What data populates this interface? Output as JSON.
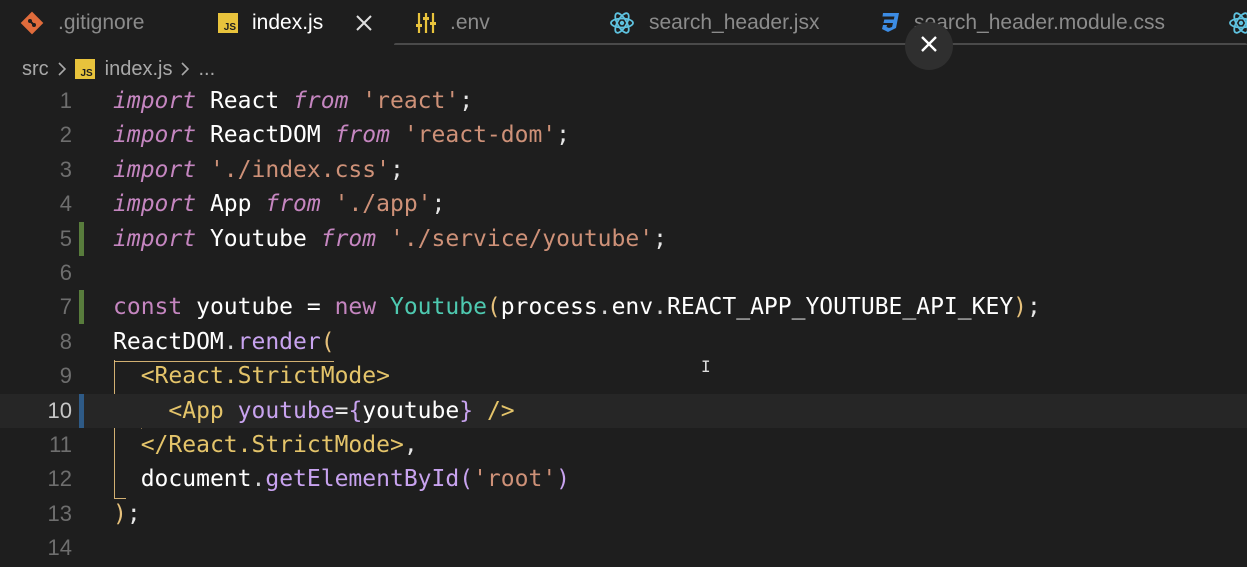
{
  "tabs": [
    {
      "label": ".gitignore",
      "icon": "git-icon"
    },
    {
      "label": "index.js",
      "icon": "js-icon",
      "active": true
    },
    {
      "label": ".env",
      "icon": "settings-sliders-icon"
    },
    {
      "label": "search_header.jsx",
      "icon": "react-icon"
    },
    {
      "label": "search_header.module.css",
      "icon": "css-icon"
    }
  ],
  "breadcrumb": {
    "folder": "src",
    "file": "index.js",
    "js_badge": "JS",
    "more": "..."
  },
  "badge_text": "JS",
  "colors": {
    "background": "#1e1e1e",
    "keyword": "#c586c0",
    "string": "#ce9178",
    "class": "#4ec9b0",
    "bracket": "#e5c07b",
    "added_marker": "#587c3c",
    "modified_marker": "#2e5a86",
    "js_badge": "#e8c33c",
    "react_icon": "#5fc3e0",
    "css_icon": "#3c8ce4",
    "git_icon": "#e06c3c"
  },
  "editor": {
    "line_numbers": [
      "1",
      "2",
      "3",
      "4",
      "5",
      "6",
      "7",
      "8",
      "9",
      "10",
      "11",
      "12",
      "13",
      "14"
    ],
    "current_line": 10,
    "lines": [
      {
        "n": 1,
        "t": [
          [
            "import",
            "kw"
          ],
          [
            " React ",
            "var"
          ],
          [
            "from",
            "kw"
          ],
          [
            " ",
            "plain"
          ],
          [
            "'react'",
            "str"
          ],
          [
            ";",
            "plain"
          ]
        ]
      },
      {
        "n": 2,
        "t": [
          [
            "import",
            "kw"
          ],
          [
            " ReactDOM ",
            "var"
          ],
          [
            "from",
            "kw"
          ],
          [
            " ",
            "plain"
          ],
          [
            "'react-dom'",
            "str"
          ],
          [
            ";",
            "plain"
          ]
        ]
      },
      {
        "n": 3,
        "t": [
          [
            "import",
            "kw"
          ],
          [
            " ",
            "plain"
          ],
          [
            "'./index.css'",
            "str"
          ],
          [
            ";",
            "plain"
          ]
        ]
      },
      {
        "n": 4,
        "t": [
          [
            "import",
            "kw"
          ],
          [
            " App ",
            "var"
          ],
          [
            "from",
            "kw"
          ],
          [
            " ",
            "plain"
          ],
          [
            "'./app'",
            "str"
          ],
          [
            ";",
            "plain"
          ]
        ]
      },
      {
        "n": 5,
        "t": [
          [
            "import",
            "kw"
          ],
          [
            " Youtube ",
            "var"
          ],
          [
            "from",
            "kw"
          ],
          [
            " ",
            "plain"
          ],
          [
            "'./service/youtube'",
            "str"
          ],
          [
            ";",
            "plain"
          ]
        ]
      },
      {
        "n": 6,
        "t": []
      },
      {
        "n": 7,
        "t": [
          [
            "const",
            "kw2"
          ],
          [
            " youtube = ",
            "var"
          ],
          [
            "new",
            "kw2"
          ],
          [
            " ",
            "plain"
          ],
          [
            "Youtube",
            "cls"
          ],
          [
            "(",
            "brace"
          ],
          [
            "process",
            "var"
          ],
          [
            ".",
            "dot"
          ],
          [
            "env",
            "var"
          ],
          [
            ".",
            "dot"
          ],
          [
            "REACT_APP_YOUTUBE_API_KEY",
            "var"
          ],
          [
            ")",
            "brace"
          ],
          [
            ";",
            "plain"
          ]
        ]
      },
      {
        "n": 8,
        "t": [
          [
            "ReactDOM",
            "var"
          ],
          [
            ".",
            "dot"
          ],
          [
            "render",
            "fn"
          ],
          [
            "(",
            "brace"
          ]
        ]
      },
      {
        "n": 9,
        "t": [
          [
            "  ",
            "plain"
          ],
          [
            "<React.StrictMode>",
            "tag"
          ]
        ]
      },
      {
        "n": 10,
        "t": [
          [
            "    ",
            "plain"
          ],
          [
            "<App",
            "tag"
          ],
          [
            " ",
            "plain"
          ],
          [
            "youtube",
            "attr"
          ],
          [
            "=",
            "plain"
          ],
          [
            "{",
            "fn"
          ],
          [
            "youtube",
            "var"
          ],
          [
            "}",
            "fn"
          ],
          [
            " ",
            "plain"
          ],
          [
            "/>",
            "tag"
          ]
        ]
      },
      {
        "n": 11,
        "t": [
          [
            "  ",
            "plain"
          ],
          [
            "</React.StrictMode>",
            "tag"
          ],
          [
            ",",
            "plain"
          ]
        ]
      },
      {
        "n": 12,
        "t": [
          [
            "  ",
            "plain"
          ],
          [
            "document",
            "var"
          ],
          [
            ".",
            "dot"
          ],
          [
            "getElementById",
            "fn"
          ],
          [
            "(",
            "fn"
          ],
          [
            "'root'",
            "str"
          ],
          [
            ")",
            "fn"
          ]
        ]
      },
      {
        "n": 13,
        "t": [
          [
            ")",
            "brace"
          ],
          [
            ";",
            "plain"
          ]
        ]
      },
      {
        "n": 14,
        "t": []
      }
    ],
    "git_markers": {
      "5": "added",
      "7": "added",
      "10": "modified"
    }
  }
}
